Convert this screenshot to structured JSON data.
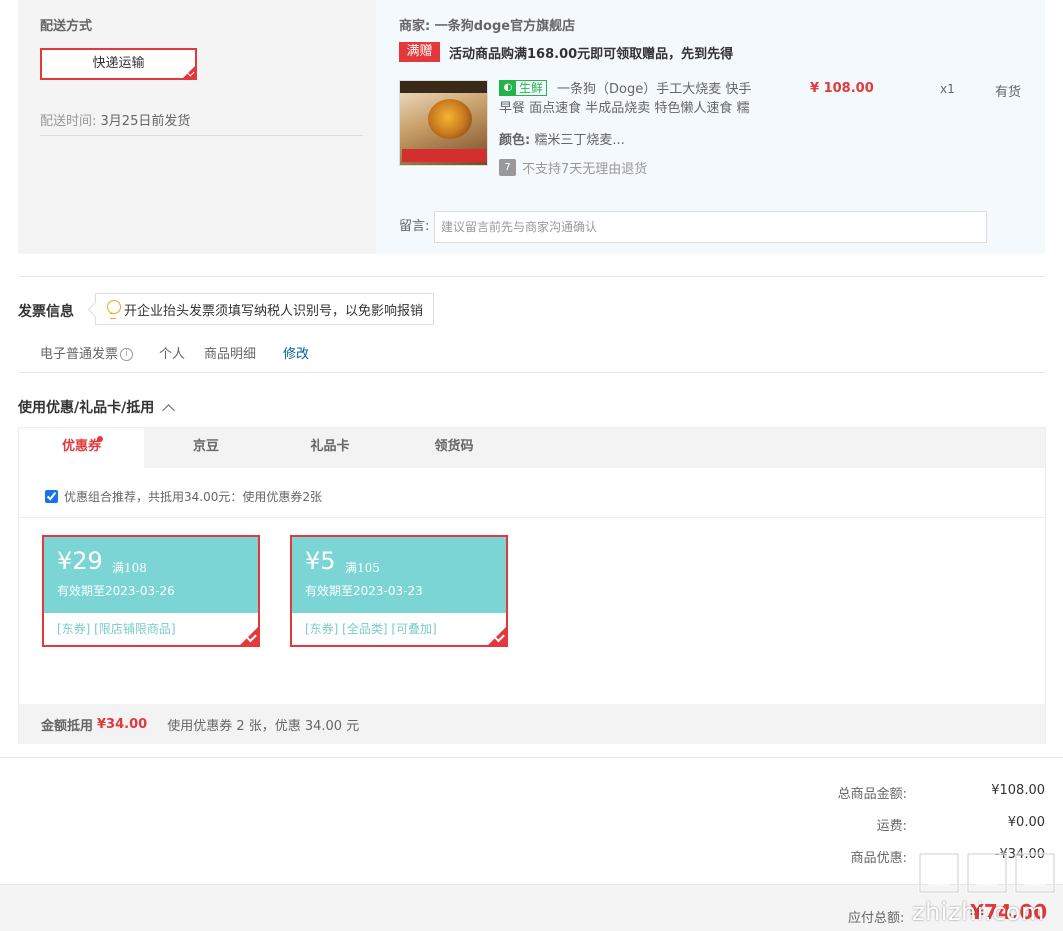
{
  "shipping": {
    "section_label": "配送方式",
    "method_button": "快递运输",
    "time_label": "配送时间:",
    "time_value": "3月25日前发货"
  },
  "merchant": {
    "label": "商家:",
    "name": "一条狗doge官方旗舰店",
    "promo_badge": "满赠",
    "promo_text": "活动商品购满168.00元即可领取赠品，先到先得"
  },
  "product": {
    "fresh_tag": "生鲜",
    "title": "一条狗（Doge）手工大烧麦 快手早餐 面点速食 半成品烧卖 特色懒人速食 糯",
    "price": "¥ 108.00",
    "quantity": "x1",
    "stock": "有货",
    "color_label": "颜色:",
    "color_value": "糯米三丁烧麦...",
    "no_return_icon_text": "7",
    "no_return_text": "不支持7天无理由退货"
  },
  "note": {
    "label": "留言:",
    "placeholder": "建议留言前先与商家沟通确认"
  },
  "invoice": {
    "title": "发票信息",
    "tip": "开企业抬头发票须填写纳税人识别号，以免影响报销",
    "type": "电子普通发票",
    "title_type": "个人",
    "content": "商品明细",
    "modify": "修改"
  },
  "coupons": {
    "title": "使用优惠/礼品卡/抵用",
    "tabs": [
      "优惠券",
      "京豆",
      "礼品卡",
      "领货码"
    ],
    "combo_text": "优惠组合推荐，共抵用34.00元：使用优惠券2张",
    "items": [
      {
        "amount": "¥29",
        "condition": "满108",
        "expiry": "有效期至2023-03-26",
        "tags": "[东券]  [限店铺限商品]"
      },
      {
        "amount": "¥5",
        "condition": "满105",
        "expiry": "有效期至2023-03-23",
        "tags": "[东券]  [全品类]  [可叠加]"
      }
    ],
    "footer_label": "金额抵用",
    "footer_amount": "¥34.00",
    "footer_desc": "使用优惠券 2 张，优惠 34.00 元"
  },
  "summary": {
    "total_label": "总商品金额:",
    "total_value": "¥108.00",
    "freight_label": "运费:",
    "freight_value": "¥0.00",
    "discount_label": "商品优惠:",
    "discount_value": "-¥34.00",
    "payable_label": "应付总额:",
    "payable_value": "¥74.00"
  },
  "watermark": "zhizhi.com",
  "colors": {
    "accent": "#e4393c",
    "coupon": "#7bd5d5",
    "fresh": "#27b34c",
    "link": "#005ea7"
  }
}
